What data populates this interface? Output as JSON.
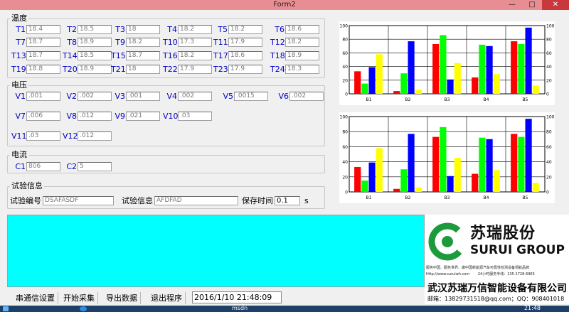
{
  "window": {
    "title": "Form2",
    "minimize": "—",
    "maximize": "□",
    "close": "✕"
  },
  "groups": {
    "temperature": "温度",
    "voltage": "电压",
    "current": "电流",
    "test_info": "试验信息"
  },
  "temperature": [
    {
      "label": "T1",
      "value": "18.4"
    },
    {
      "label": "T2",
      "value": "18.5"
    },
    {
      "label": "T3",
      "value": "18"
    },
    {
      "label": "T4",
      "value": "18.2"
    },
    {
      "label": "T5",
      "value": "18.2"
    },
    {
      "label": "T6",
      "value": "18.6"
    },
    {
      "label": "T7",
      "value": "18.7"
    },
    {
      "label": "T8",
      "value": "18.9"
    },
    {
      "label": "T9",
      "value": "18.2"
    },
    {
      "label": "T10",
      "value": "17.3"
    },
    {
      "label": "T11",
      "value": "17.9"
    },
    {
      "label": "T12",
      "value": "18.2"
    },
    {
      "label": "T13",
      "value": "18.7"
    },
    {
      "label": "T14",
      "value": "18.5"
    },
    {
      "label": "T15",
      "value": "18.7"
    },
    {
      "label": "T16",
      "value": "18.2"
    },
    {
      "label": "T17",
      "value": "18.6"
    },
    {
      "label": "T18",
      "value": "18.9"
    },
    {
      "label": "T19",
      "value": "18.8"
    },
    {
      "label": "T20",
      "value": "18.9"
    },
    {
      "label": "T21",
      "value": "18"
    },
    {
      "label": "T22",
      "value": "17.9"
    },
    {
      "label": "T23",
      "value": "17.9"
    },
    {
      "label": "T24",
      "value": "18.3"
    }
  ],
  "voltage": [
    {
      "label": "V1",
      "value": ".001"
    },
    {
      "label": "V2",
      "value": ".002"
    },
    {
      "label": "V3",
      "value": ".001"
    },
    {
      "label": "V4",
      "value": ".002"
    },
    {
      "label": "V5",
      "value": ".0015"
    },
    {
      "label": "V6",
      "value": ".002"
    },
    {
      "label": "V7",
      "value": ".006"
    },
    {
      "label": "V8",
      "value": ".012"
    },
    {
      "label": "V9",
      "value": ".021"
    },
    {
      "label": "V10",
      "value": ".03"
    },
    {
      "label": "V11",
      "value": ".03"
    },
    {
      "label": "V12",
      "value": ".012"
    }
  ],
  "current": [
    {
      "label": "C1",
      "value": "806"
    },
    {
      "label": "C2",
      "value": "5"
    }
  ],
  "test_info": {
    "id_label": "试验编号",
    "id_value": "DSAFASDF",
    "info_label": "试验信息",
    "info_value": "AFDFAD",
    "save_label": "保存时间",
    "save_value": "0.1",
    "save_unit": "s"
  },
  "buttons": {
    "serial": "串通信设置",
    "start": "开始采集",
    "export": "导出数据",
    "exit": "退出程序"
  },
  "datetime": "2016/1/10 21:48:09",
  "logo": {
    "name_cn": "苏瑞股份",
    "name_en": "SURUI GROUP",
    "slogan": "服务中国、服务世界、做中国新能源汽车可靠性检测设备领航品牌",
    "web": "Http://www.suruiwh.com",
    "hotline": "24小时服务专线：135-1728-6965",
    "company": "武汉苏瑞万信智能设备有限公司",
    "email": "邮箱：1382973151​8@qq.com；QQ：908401018"
  },
  "taskbar": {
    "app": "msdn",
    "time": "21:48"
  },
  "colors": {
    "red": "#ff0000",
    "green": "#00ff00",
    "blue": "#0000ff",
    "yellow": "#ffff00"
  },
  "chart_data": [
    {
      "type": "bar",
      "categories": [
        "B1",
        "B2",
        "B3",
        "B4",
        "B5"
      ],
      "ylim": [
        0,
        100
      ],
      "y2lim": [
        0,
        100
      ],
      "yticks": [
        0,
        20,
        40,
        60,
        80,
        100
      ],
      "series": [
        {
          "color": "#ff0000",
          "values": [
            33,
            4,
            73,
            24,
            77
          ]
        },
        {
          "color": "#00ff00",
          "values": [
            15,
            30,
            86,
            72,
            73
          ]
        },
        {
          "color": "#0000ff",
          "values": [
            39,
            77,
            21,
            70,
            97
          ]
        },
        {
          "color": "#ffff00",
          "values": [
            58,
            6,
            45,
            29,
            12
          ]
        }
      ]
    },
    {
      "type": "bar",
      "categories": [
        "B1",
        "B2",
        "B3",
        "B4",
        "B5"
      ],
      "ylim": [
        0,
        100
      ],
      "y2lim": [
        0,
        100
      ],
      "yticks": [
        0,
        20,
        40,
        60,
        80,
        100
      ],
      "series": [
        {
          "color": "#ff0000",
          "values": [
            33,
            4,
            73,
            24,
            77
          ]
        },
        {
          "color": "#00ff00",
          "values": [
            15,
            30,
            86,
            72,
            73
          ]
        },
        {
          "color": "#0000ff",
          "values": [
            39,
            77,
            21,
            70,
            97
          ]
        },
        {
          "color": "#ffff00",
          "values": [
            58,
            6,
            45,
            29,
            12
          ]
        }
      ]
    }
  ]
}
